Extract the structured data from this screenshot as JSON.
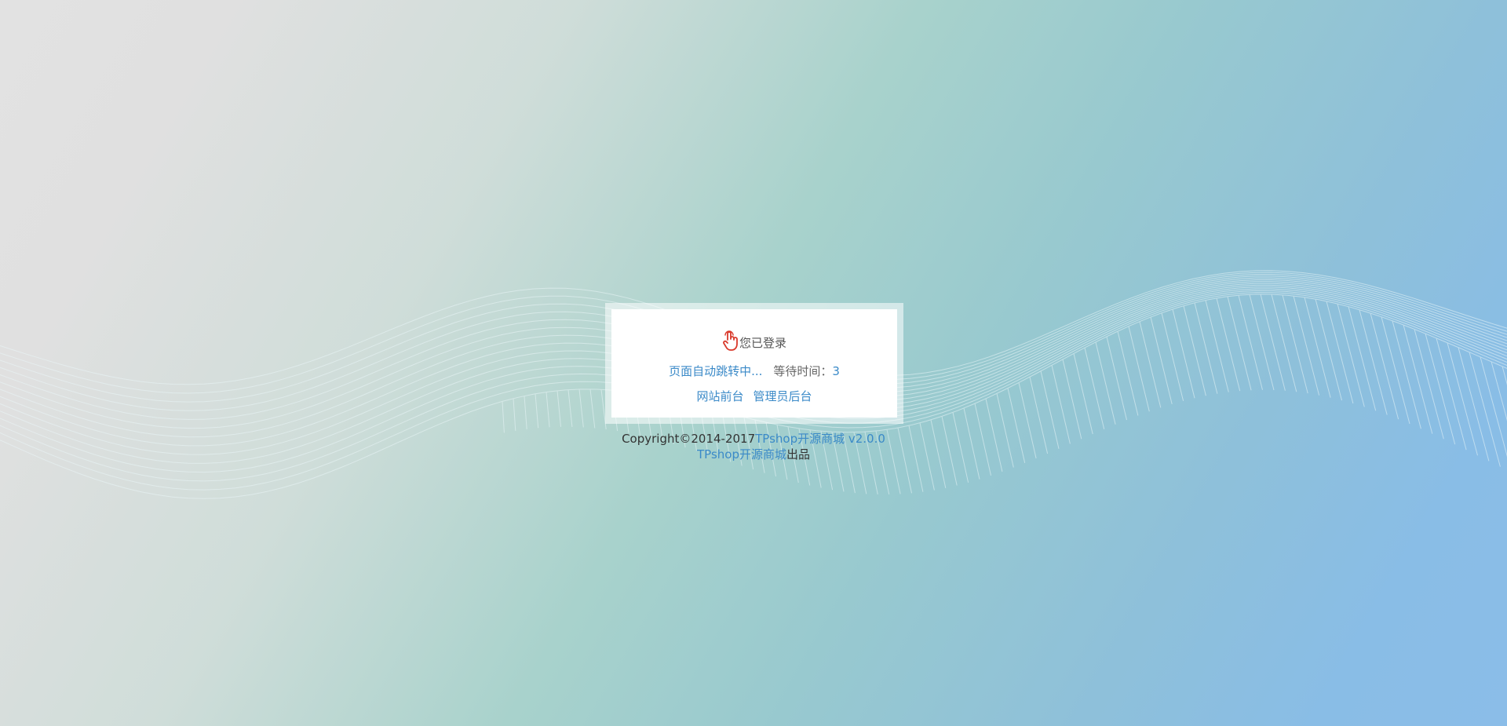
{
  "status": {
    "icon": "hand-pointer-icon",
    "icon_color": "#d9392b",
    "message": "您已登录"
  },
  "redirect": {
    "auto_text": "页面自动跳转中...",
    "wait_label": "等待时间：",
    "wait_seconds": "3"
  },
  "links": {
    "frontend": "网站前台",
    "admin": "管理员后台"
  },
  "footer": {
    "copyright_prefix": "Copyright©2014-2017",
    "product_link": "TPshop开源商城 v2.0.0",
    "brand_link": "TPshop开源商城",
    "brand_suffix": "出品"
  },
  "colors": {
    "link": "#3b8ac8",
    "text": "#555555",
    "wave_lines": "#e8f4f7"
  }
}
